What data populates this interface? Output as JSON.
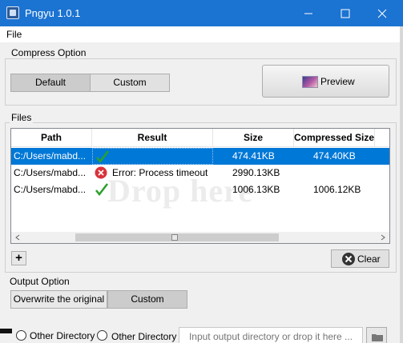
{
  "window": {
    "title": "Pngyu 1.0.1"
  },
  "menu": {
    "file": "File"
  },
  "compress": {
    "label": "Compress Option",
    "default_label": "Default",
    "custom_label": "Custom",
    "preview_label": "Preview"
  },
  "files": {
    "label": "Files",
    "columns": [
      "Path",
      "Result",
      "Size",
      "Compressed Size"
    ],
    "rows": [
      {
        "path": "C:/Users/mabd...",
        "result": "",
        "result_icon": "check-icon",
        "size": "474.41KB",
        "compressed": "474.40KB",
        "selected": true
      },
      {
        "path": "C:/Users/mabd...",
        "result": "Error: Process timeout",
        "result_icon": "error-icon",
        "size": "2990.13KB",
        "compressed": "",
        "selected": false
      },
      {
        "path": "C:/Users/mabd...",
        "result": "",
        "result_icon": "check-icon",
        "size": "1006.13KB",
        "compressed": "1006.12KB",
        "selected": false
      }
    ],
    "watermark": "Drop here",
    "add_label": "+",
    "clear_label": "Clear"
  },
  "output": {
    "label": "Output Option",
    "overwrite_label": "Overwrite the original",
    "custom_label": "Custom",
    "other_directory_1": "Other Directory",
    "other_directory_2": "Other Directory",
    "directory_placeholder": "Input output directory or drop it here ..."
  },
  "colors": {
    "titlebar": "#1b73d2",
    "selection": "#0078d7",
    "check": "#2aa12a",
    "error": "#d9333a"
  }
}
